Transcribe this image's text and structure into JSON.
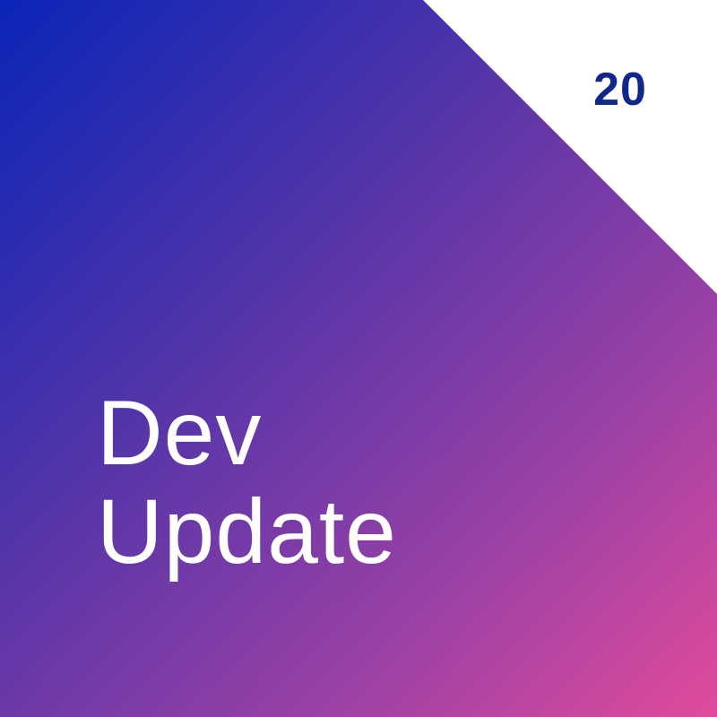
{
  "card": {
    "title_line_1": "Dev",
    "title_line_2": "Update",
    "issue_number": "20"
  },
  "colors": {
    "gradient_start": "#0a25b8",
    "gradient_mid": "#9640a6",
    "gradient_end": "#e04b9c",
    "corner": "#ffffff",
    "number_text": "#10288c",
    "title_text": "#ffffff"
  }
}
